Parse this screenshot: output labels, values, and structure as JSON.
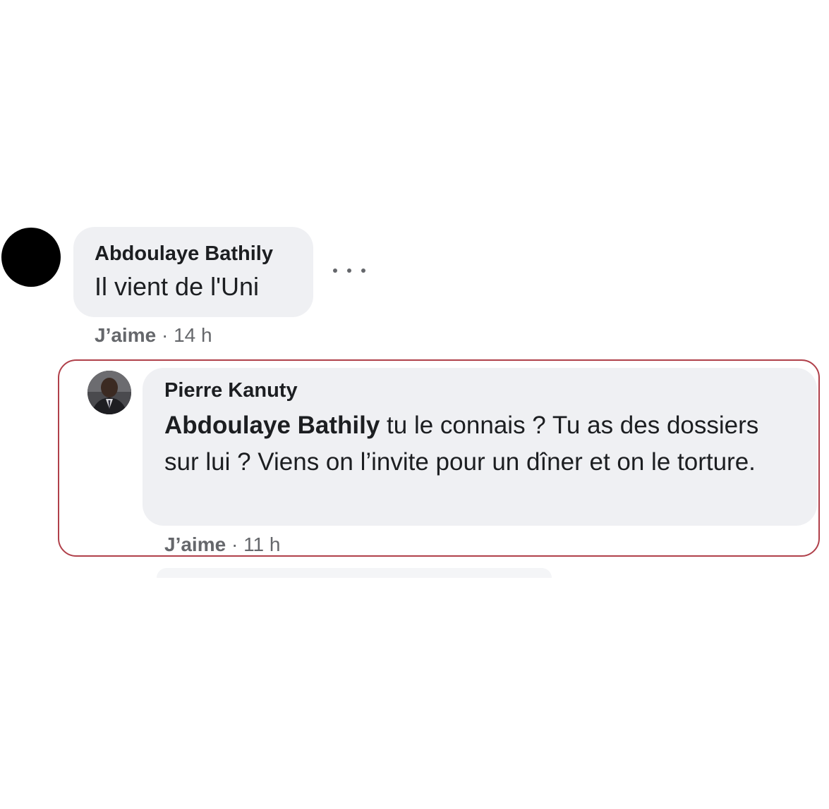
{
  "comments": [
    {
      "author": "Abdoulaye Bathily",
      "text": "Il vient de l'Uni",
      "like_label": "J’aime",
      "separator": " · ",
      "time": "14 h"
    }
  ],
  "reply": {
    "author": "Pierre Kanuty",
    "mention": "Abdoulaye Bathily",
    "text": " tu le connais ? Tu as des dossiers sur lui ? Viens on l’invite pour un dîner et on le torture.",
    "like_label": "J’aime",
    "separator": " · ",
    "time": "11 h"
  },
  "colors": {
    "bubble": "#eff0f3",
    "text": "#1c1e21",
    "meta": "#65676b",
    "highlight_border": "#b0404a"
  },
  "icons": {
    "more": "more-options-icon"
  }
}
